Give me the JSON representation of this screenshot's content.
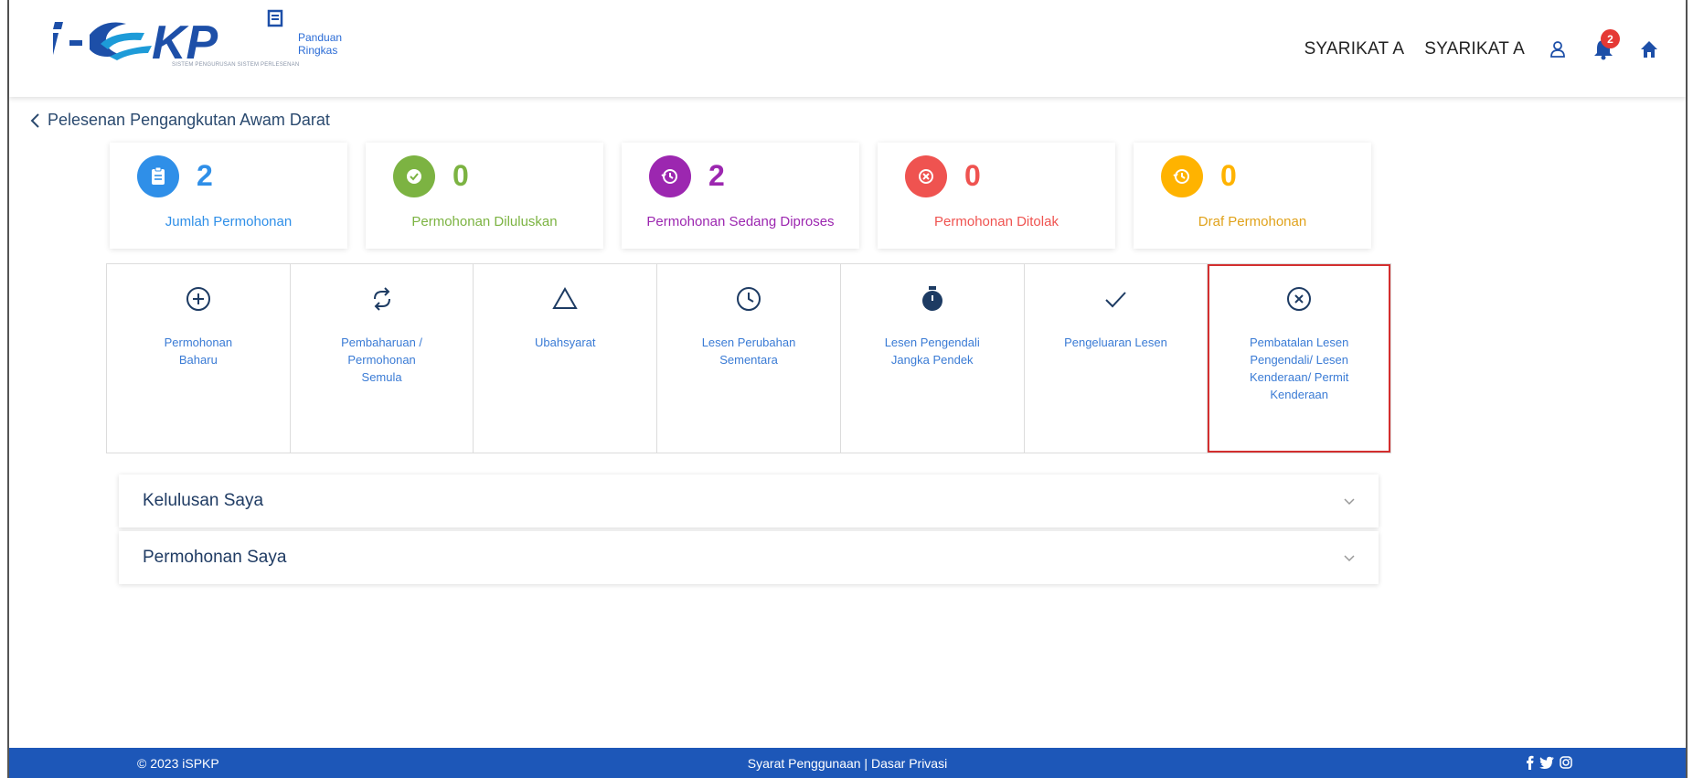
{
  "header": {
    "logo_text": "i-SPKP",
    "guide_label": "Panduan Ringkas",
    "logo_subtitle": "SISTEM PENGURUSAN SISTEM PERLESENAN",
    "company_name_1": "SYARIKAT A",
    "company_name_2": "SYARIKAT A",
    "notification_count": "2",
    "icons": [
      "user-icon",
      "bell-icon",
      "home-icon"
    ]
  },
  "breadcrumb": {
    "label": "Pelesenan Pengangkutan Awam Darat"
  },
  "stats": [
    {
      "count": "2",
      "label": "Jumlah Permohonan",
      "color": "#2f8fe8",
      "icon": "clipboard-icon"
    },
    {
      "count": "0",
      "label": "Permohonan Diluluskan",
      "color": "#7cb342",
      "icon": "check-icon"
    },
    {
      "count": "2",
      "label": "Permohonan Sedang Diproses",
      "color": "#9c27b0",
      "icon": "history-icon"
    },
    {
      "count": "0",
      "label": "Permohonan Ditolak",
      "color": "#ef5350",
      "icon": "cancel-icon"
    },
    {
      "count": "0",
      "label": "Draf Permohonan",
      "color": "#ffb300",
      "icon": "history-icon"
    }
  ],
  "services": [
    {
      "label": "Permohonan Baharu",
      "icon": "plus-circle-icon"
    },
    {
      "label": "Pembaharuan / Permohonan Semula",
      "icon": "sync-icon"
    },
    {
      "label": "Ubahsyarat",
      "icon": "triangle-icon"
    },
    {
      "label": "Lesen Perubahan Sementara",
      "icon": "clock-icon"
    },
    {
      "label": "Lesen Pengendali Jangka Pendek",
      "icon": "stopwatch-icon"
    },
    {
      "label": "Pengeluaran Lesen",
      "icon": "check-icon"
    },
    {
      "label": "Pembatalan Lesen Pengendali/ Lesen Kenderaan/ Permit Kenderaan",
      "icon": "x-circle-icon"
    }
  ],
  "accordions": [
    {
      "title": "Kelulusan Saya"
    },
    {
      "title": "Permohonan Saya"
    }
  ],
  "footer": {
    "copyright": "© 2023 iSPKP",
    "links": "Syarat Penggunaan | Dasar Privasi",
    "social": [
      "facebook-icon",
      "twitter-icon",
      "instagram-icon"
    ]
  }
}
